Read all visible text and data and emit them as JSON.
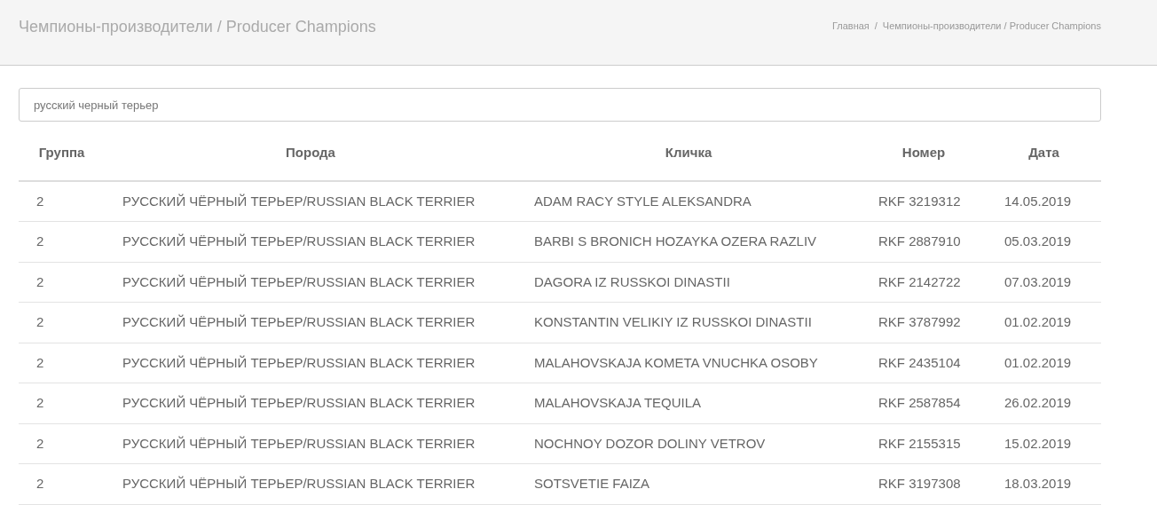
{
  "header": {
    "title": "Чемпионы-производители / Producer Champions",
    "breadcrumbs": [
      "Главная",
      "Чемпионы-производители / Producer Champions"
    ],
    "separator": "/"
  },
  "search": {
    "value": "русский черный терьер"
  },
  "table": {
    "columns": [
      "Группа",
      "Порода",
      "Кличка",
      "Номер",
      "Дата"
    ],
    "rows": [
      [
        "2",
        "РУССКИЙ ЧЁРНЫЙ ТЕРЬЕР/RUSSIAN BLACK TERRIER",
        "ADAM RACY STYLE ALEKSANDRA",
        "RKF 3219312",
        "14.05.2019"
      ],
      [
        "2",
        "РУССКИЙ ЧЁРНЫЙ ТЕРЬЕР/RUSSIAN BLACK TERRIER",
        "BARBI S BRONICH HOZAYKA OZERA RAZLIV",
        "RKF 2887910",
        "05.03.2019"
      ],
      [
        "2",
        "РУССКИЙ ЧЁРНЫЙ ТЕРЬЕР/RUSSIAN BLACK TERRIER",
        "DAGORA IZ RUSSKOI DINASTII",
        "RKF 2142722",
        "07.03.2019"
      ],
      [
        "2",
        "РУССКИЙ ЧЁРНЫЙ ТЕРЬЕР/RUSSIAN BLACK TERRIER",
        "KONSTANTIN VELIKIY IZ RUSSKOI DINASTII",
        "RKF 3787992",
        "01.02.2019"
      ],
      [
        "2",
        "РУССКИЙ ЧЁРНЫЙ ТЕРЬЕР/RUSSIAN BLACK TERRIER",
        "MALAHOVSKAJA KOMETA VNUCHKA OSOBY",
        "RKF 2435104",
        "01.02.2019"
      ],
      [
        "2",
        "РУССКИЙ ЧЁРНЫЙ ТЕРЬЕР/RUSSIAN BLACK TERRIER",
        "MALAHOVSKAJA TEQUILA",
        "RKF 2587854",
        "26.02.2019"
      ],
      [
        "2",
        "РУССКИЙ ЧЁРНЫЙ ТЕРЬЕР/RUSSIAN BLACK TERRIER",
        "NOCHNOY DOZOR DOLINY VETROV",
        "RKF 2155315",
        "15.02.2019"
      ],
      [
        "2",
        "РУССКИЙ ЧЁРНЫЙ ТЕРЬЕР/RUSSIAN BLACK TERRIER",
        "SOTSVETIE FAIZA",
        "RKF 3197308",
        "18.03.2019"
      ]
    ]
  }
}
